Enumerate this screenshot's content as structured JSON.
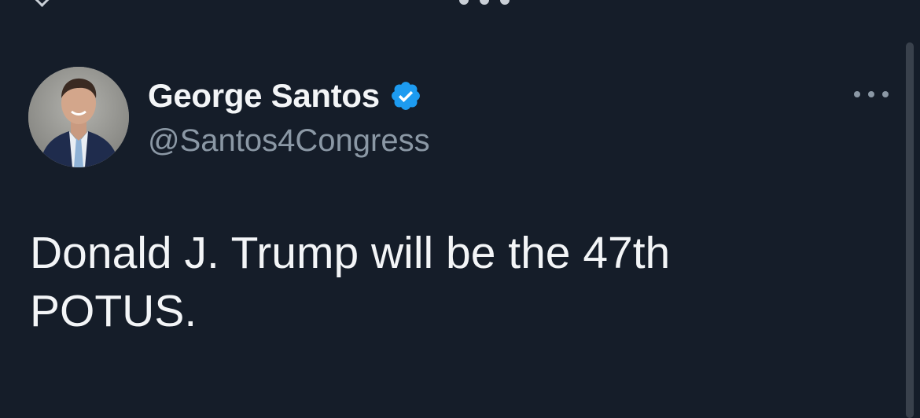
{
  "tweet": {
    "author": {
      "display_name": "George Santos",
      "handle": "@Santos4Congress",
      "verified": true
    },
    "text": "Donald J. Trump will be the 47th\nPOTUS."
  },
  "icons": {
    "verified": "verified-badge-icon",
    "more": "more-options-icon",
    "back": "back-chevron-icon"
  },
  "colors": {
    "background": "#151d29",
    "primary_text": "#f3f5f7",
    "secondary_text": "#8b98a5",
    "verified_badge": "#1d9bf0"
  }
}
